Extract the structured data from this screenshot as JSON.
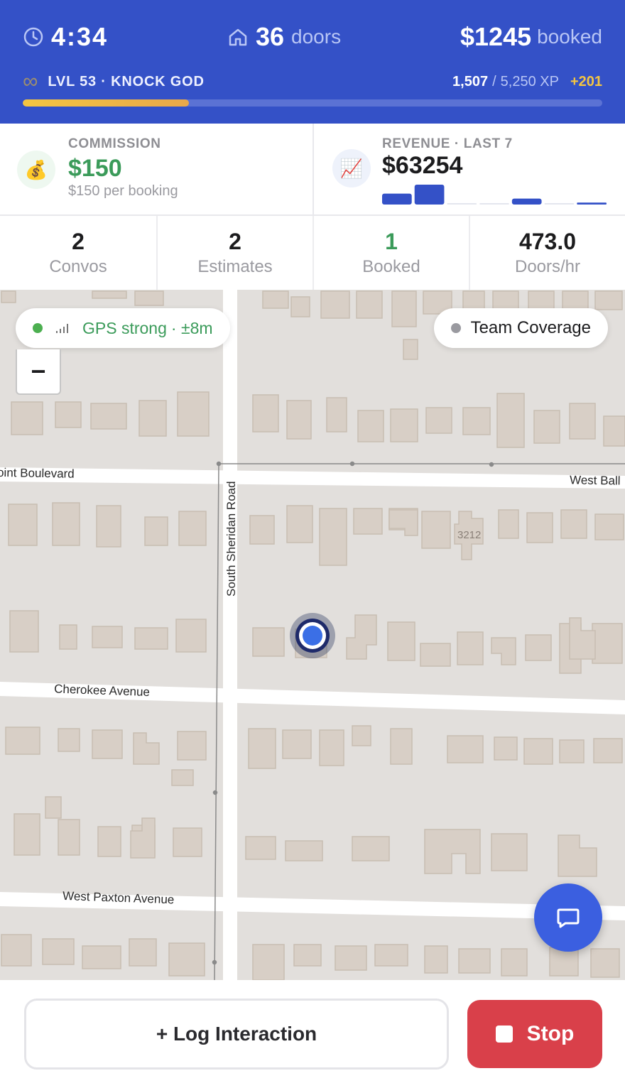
{
  "header": {
    "timer": "4:34",
    "doors_count": "36",
    "doors_label": "doors",
    "booked_amount": "$1245",
    "booked_label": "booked",
    "level_label": "LVL 53 · KNOCK GOD",
    "xp_current": "1,507",
    "xp_separator": "/",
    "xp_max": "5,250 XP",
    "xp_gain": "+201",
    "xp_progress": 0.287,
    "colors": {
      "background": "#3451c7",
      "xp_fill": "#f4c542"
    }
  },
  "commission_card": {
    "icon": "money-bag-icon",
    "icon_glyph": "💰",
    "title": "COMMISSION",
    "value": "$150",
    "subtitle": "$150 per booking"
  },
  "revenue_card": {
    "icon": "chart-increasing-icon",
    "icon_glyph": "📈",
    "title": "REVENUE · LAST 7",
    "value": "$63254",
    "sparkline_levels": [
      0.55,
      1.0,
      0.05,
      0.05,
      0.3,
      0.05,
      0.1
    ]
  },
  "metrics": [
    {
      "value": "2",
      "label": "Convos",
      "accent": false
    },
    {
      "value": "2",
      "label": "Estimates",
      "accent": false
    },
    {
      "value": "1",
      "label": "Booked",
      "accent": true
    },
    {
      "value": "473.0",
      "label": "Doors/hr",
      "accent": false
    }
  ],
  "map": {
    "gps_status": "GPS strong",
    "gps_accuracy": "· ±8m",
    "team_coverage_label": "Team Coverage",
    "zoom_out_label": "−",
    "streets": [
      "oint Boulevard",
      "West Ball",
      "South Sheridan Road",
      "Cherokee Avenue",
      "West Paxton Avenue"
    ],
    "house_number": "3212"
  },
  "actions": {
    "log_label": "+ Log Interaction",
    "stop_label": "Stop"
  }
}
